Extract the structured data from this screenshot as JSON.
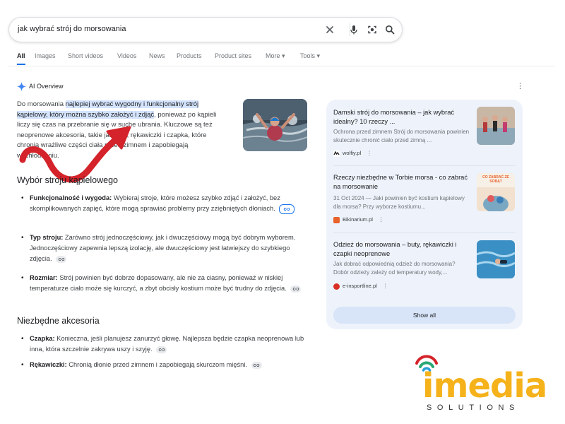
{
  "search": {
    "query": "jak wybrać strój do morsowania"
  },
  "tabs": [
    {
      "label": "All"
    },
    {
      "label": "Images"
    },
    {
      "label": "Short videos"
    },
    {
      "label": "Videos"
    },
    {
      "label": "News"
    },
    {
      "label": "Products"
    },
    {
      "label": "Product sites"
    },
    {
      "label": "More"
    },
    {
      "label": "Tools"
    }
  ],
  "ai_overview": {
    "label": "AI Overview",
    "intro": {
      "p1": "Do morsowania ",
      "highlight": "najlepiej wybrać wygodny i funkcjonalny strój kąpielowy, który można szybko założyć i zdjąć",
      "p2": ", ponieważ po kąpieli liczy się czas na przebranie się w suche ubrania. Kluczowe są też neoprenowe akcesoria, takie jak buty, rękawiczki i czapka, które chronią wrażliwe części ciała przed zimnem i zapobiegają wychłodzeniu."
    },
    "section1": {
      "heading": "Wybór stroju kąpielowego",
      "items": [
        {
          "term": "Funkcjonalność i wygoda:",
          "text": " Wybieraj stroje, które możesz szybko zdjąć i założyć, bez skomplikowanych zapięć, które mogą sprawiać problemy przy zziębniętych dłoniach."
        },
        {
          "term": "Typ stroju:",
          "text": " Zarówno strój jednoczęściowy, jak i dwuczęściowy mogą być dobrym wyborem. Jednoczęściowy zapewnia lepszą izolację, ale dwuczęściowy jest łatwiejszy do szybkiego zdjęcia."
        },
        {
          "term": "Rozmiar:",
          "text": " Strój powinien być dobrze dopasowany, ale nie za ciasny, ponieważ w niskiej temperaturze ciało może się kurczyć, a zbyt obcisły kostium może być trudny do zdjęcia."
        }
      ]
    },
    "section2": {
      "heading": "Niezbędne akcesoria",
      "items": [
        {
          "term": "Czapka:",
          "text": " Konieczna, jeśli planujesz zanurzyć głowę. Najlepsza będzie czapka neoprenowa lub inna, która szczelnie zakrywa uszy i szyję."
        },
        {
          "term": "Rękawiczki:",
          "text": " Chronią dłonie przed zimnem i zapobiegają skurczom mięśni."
        }
      ]
    }
  },
  "sources": {
    "cards": [
      {
        "title": "Damski strój do morsowania – jak wybrać idealny? 10 rzeczy ...",
        "snippet": "Ochrona przed zimnem Strój do morsowania powinien skutecznie chronić ciało przed zimną ...",
        "site": "wolfiy.pl",
        "favicon_color": "#1f1f1f"
      },
      {
        "title": "Rzeczy niezbędne w Torbie morsa - co zabrać na morsowanie",
        "snippet": "31 Oct 2024 — Jaki powinien być kostium kąpielowy dla morsa? Przy wyborze kostiumu...",
        "site": "Bikinarium.pl",
        "favicon_color": "#e8622c",
        "image_caption": "CO ZABRAĆ ZE SOBĄ?"
      },
      {
        "title": "Odzież do morsowania – buty, rękawiczki i czapki neoprenowe",
        "snippet": "Jak dobrać odpowiednią odzież do morsowania? Dobór odzieży zależy od temperatury wody,...",
        "site": "e-insportline.pl",
        "favicon_color": "#d93025"
      }
    ],
    "show_all": "Show all"
  },
  "logo": {
    "main": "imedia",
    "sub": "SOLUTIONS",
    "color": "#f5b21b"
  },
  "colors": {
    "accent": "#1a73e8",
    "highlight": "#d3e3fd",
    "panel": "#eef3fb",
    "arrow": "#d4232a"
  }
}
